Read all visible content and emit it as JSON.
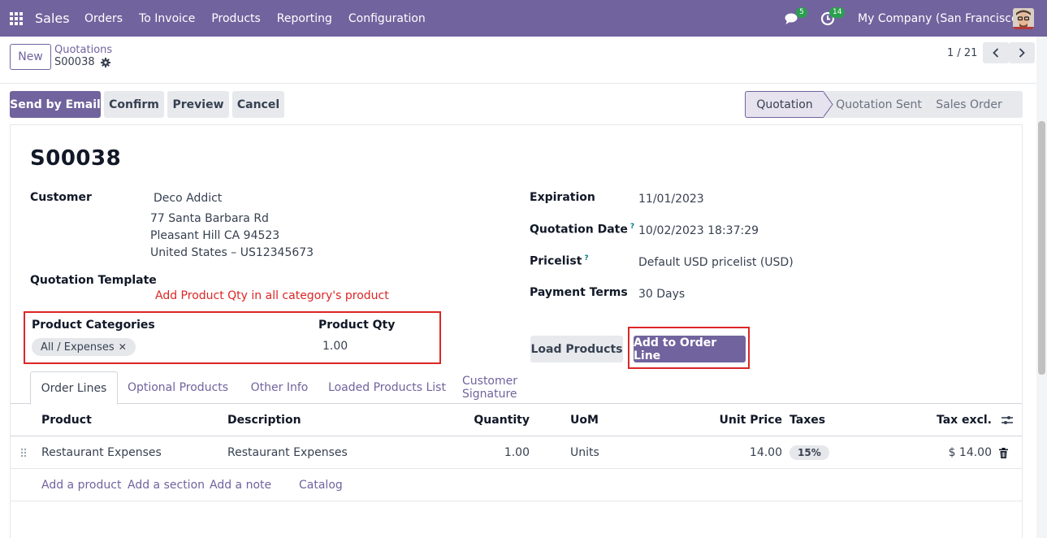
{
  "navbar": {
    "app_name": "Sales",
    "menu": [
      "Orders",
      "To Invoice",
      "Products",
      "Reporting",
      "Configuration"
    ],
    "messages_count": "5",
    "activities_count": "14",
    "company": "My Company (San Francisco)"
  },
  "control_panel": {
    "new_label": "New",
    "breadcrumb_parent": "Quotations",
    "breadcrumb_current": "S00038",
    "pager": "1 / 21"
  },
  "actions": {
    "send_by_email": "Send by Email",
    "confirm": "Confirm",
    "preview": "Preview",
    "cancel": "Cancel"
  },
  "statusbar": [
    "Quotation",
    "Quotation Sent",
    "Sales Order"
  ],
  "form": {
    "title": "S00038",
    "customer_label": "Customer",
    "customer_name": "Deco Addict",
    "customer_address": [
      "77 Santa Barbara Rd",
      "Pleasant Hill CA 94523",
      "United States – US12345673"
    ],
    "quotation_template_label": "Quotation Template",
    "annotation": "Add Product Qty in all category's product",
    "product_categories_label": "Product Categories",
    "product_category_tag": "All / Expenses",
    "product_qty_label": "Product Qty",
    "product_qty_value": "1.00",
    "expiration_label": "Expiration",
    "expiration_value": "11/01/2023",
    "quotation_date_label": "Quotation Date",
    "quotation_date_value": "10/02/2023 18:37:29",
    "pricelist_label": "Pricelist",
    "pricelist_value": "Default USD pricelist (USD)",
    "payment_terms_label": "Payment Terms",
    "payment_terms_value": "30 Days",
    "help_mark": "?",
    "load_products": "Load Products",
    "add_to_order_line": "Add to Order Line"
  },
  "tabs": [
    "Order Lines",
    "Optional Products",
    "Other Info",
    "Loaded Products List",
    "Customer Signature"
  ],
  "order_lines": {
    "columns": [
      "Product",
      "Description",
      "Quantity",
      "UoM",
      "Unit Price",
      "Taxes",
      "Tax excl."
    ],
    "rows": [
      {
        "product": "Restaurant Expenses",
        "description": "Restaurant Expenses",
        "quantity": "1.00",
        "uom": "Units",
        "unit_price": "14.00",
        "taxes": "15%",
        "subtotal": "$ 14.00"
      }
    ],
    "add_links": [
      "Add a product",
      "Add a section",
      "Add a note",
      "Catalog"
    ]
  },
  "colors": {
    "brand": "#71639e",
    "annotation_red": "#dc2626",
    "badge_green": "#2aa04e"
  }
}
